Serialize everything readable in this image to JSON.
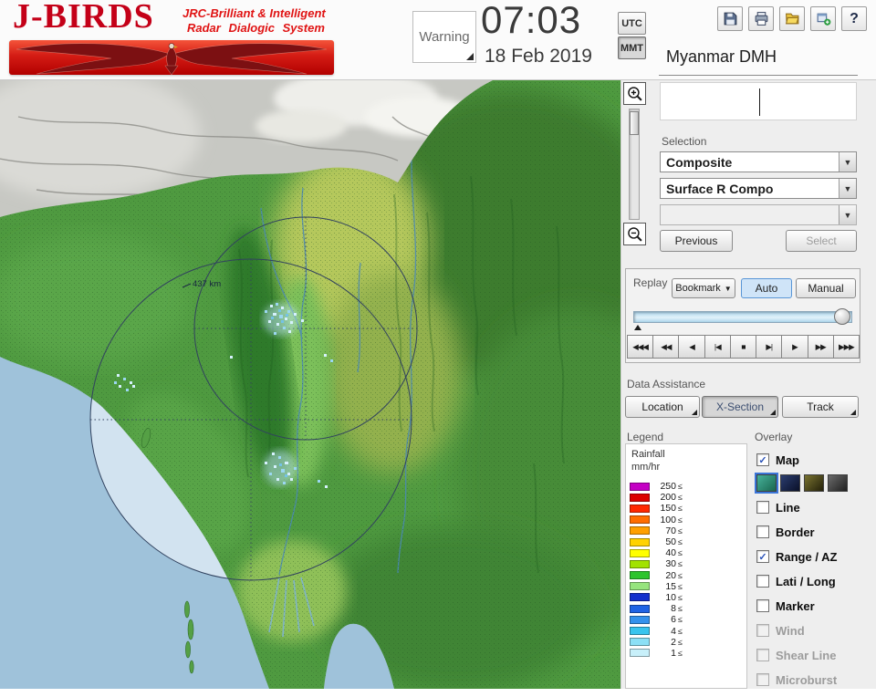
{
  "header": {
    "logo": {
      "title": "J-BIRDS",
      "subtitle_line1": "JRC-Brilliant & Intelligent",
      "subtitle_line2": "Radar  Dialogic  System"
    },
    "warning_button": "Warning",
    "clock": {
      "time": "07:03",
      "date": "18 Feb 2019"
    },
    "timezone": {
      "utc": "UTC",
      "mmt": "MMT"
    },
    "station": "Myanmar DMH",
    "toolbar": {
      "help_glyph": "?",
      "icons": [
        "save",
        "print",
        "open",
        "export",
        "help"
      ]
    }
  },
  "zoom": {
    "in_glyph": "+",
    "out_glyph": "−"
  },
  "selection_panel": {
    "label": "Selection",
    "product_value": "Composite",
    "type_value": "Surface R Compo",
    "extra_value": "",
    "previous_label": "Previous",
    "select_label": "Select"
  },
  "replay_panel": {
    "label": "Replay",
    "bookmark_label": "Bookmark",
    "auto_label": "Auto",
    "manual_label": "Manual",
    "playback_buttons": [
      "◀◀◀",
      "◀◀",
      "◀",
      "|◀",
      "■",
      "▶|",
      "▶",
      "▶▶",
      "▶▶▶"
    ]
  },
  "data_assistance": {
    "label": "Data Assistance",
    "location_label": "Location",
    "xsection_label": "X-Section",
    "track_label": "Track"
  },
  "legend": {
    "label": "Legend",
    "unit_line1": "Rainfall",
    "unit_line2": "mm/hr",
    "lte_glyph": "≤",
    "entries": [
      {
        "value": "250",
        "color": "#c400c4"
      },
      {
        "value": "200",
        "color": "#dc0000"
      },
      {
        "value": "150",
        "color": "#ff2800"
      },
      {
        "value": "100",
        "color": "#ff6e00"
      },
      {
        "value": "70",
        "color": "#ffa000"
      },
      {
        "value": "50",
        "color": "#ffd200"
      },
      {
        "value": "40",
        "color": "#ffff00"
      },
      {
        "value": "30",
        "color": "#a2e200"
      },
      {
        "value": "20",
        "color": "#2cc42c"
      },
      {
        "value": "15",
        "color": "#96e47e"
      },
      {
        "value": "10",
        "color": "#1430cc"
      },
      {
        "value": "8",
        "color": "#2064e4"
      },
      {
        "value": "6",
        "color": "#3492ec"
      },
      {
        "value": "4",
        "color": "#38c4ee"
      },
      {
        "value": "2",
        "color": "#8ce0f6"
      },
      {
        "value": "1",
        "color": "#c8f0fa"
      }
    ]
  },
  "overlay": {
    "label": "Overlay",
    "items": [
      {
        "label": "Map",
        "checked": true,
        "enabled": true
      },
      {
        "label": "Line",
        "checked": false,
        "enabled": true
      },
      {
        "label": "Border",
        "checked": false,
        "enabled": true
      },
      {
        "label": "Range / AZ",
        "checked": true,
        "enabled": true
      },
      {
        "label": "Lati / Long",
        "checked": false,
        "enabled": true
      },
      {
        "label": "Marker",
        "checked": false,
        "enabled": true
      },
      {
        "label": "Wind",
        "checked": false,
        "enabled": false
      },
      {
        "label": "Shear Line",
        "checked": false,
        "enabled": false
      },
      {
        "label": "Microburst",
        "checked": false,
        "enabled": false
      }
    ],
    "map_styles": [
      {
        "c1": "#46b29a",
        "c2": "#19664f"
      },
      {
        "c1": "#2b3d70",
        "c2": "#0a1028"
      },
      {
        "c1": "#7a7430",
        "c2": "#23200a"
      },
      {
        "c1": "#6a6a6a",
        "c2": "#1f1f1f"
      }
    ]
  },
  "map": {
    "range_label": "437 km"
  }
}
